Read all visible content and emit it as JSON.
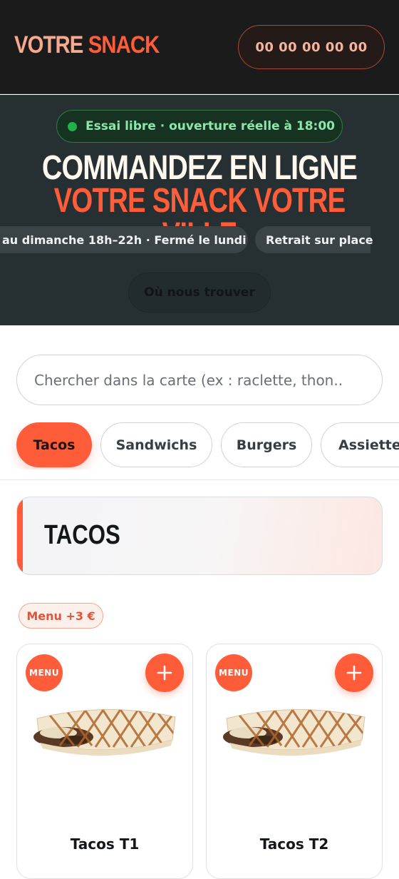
{
  "header": {
    "brand_part1": "VOTRE",
    "brand_part2": "SNACK",
    "phone": "00 00 00 00 00"
  },
  "hero": {
    "status_badge": "Essai libre · ouverture réelle à 18:00",
    "title_line1": "COMMANDEZ EN LIGNE",
    "title_line2": "VOTRE SNACK VOTRE VILLE",
    "info_pills": [
      "au dimanche 18h–22h · Fermé le lundi",
      "Retrait sur place"
    ],
    "locate_button": "Où nous trouver"
  },
  "search": {
    "placeholder": "Chercher dans la carte (ex : raclette, thon..",
    "value": ""
  },
  "categories": [
    {
      "label": "Tacos",
      "active": true
    },
    {
      "label": "Sandwichs",
      "active": false
    },
    {
      "label": "Burgers",
      "active": false
    },
    {
      "label": "Assiettes",
      "active": false
    }
  ],
  "section": {
    "title": "TACOS",
    "menu_tag": "Menu +3 €"
  },
  "products": [
    {
      "badge": "MENU",
      "name": "Tacos T1",
      "image_icon": "tacos-image"
    },
    {
      "badge": "MENU",
      "name": "Tacos T2",
      "image_icon": "tacos-image"
    }
  ],
  "colors": {
    "accent": "#ff5c3a",
    "header_bg": "#1b1b1b",
    "hero_bg": "#263033",
    "status_green": "#22b04a"
  }
}
